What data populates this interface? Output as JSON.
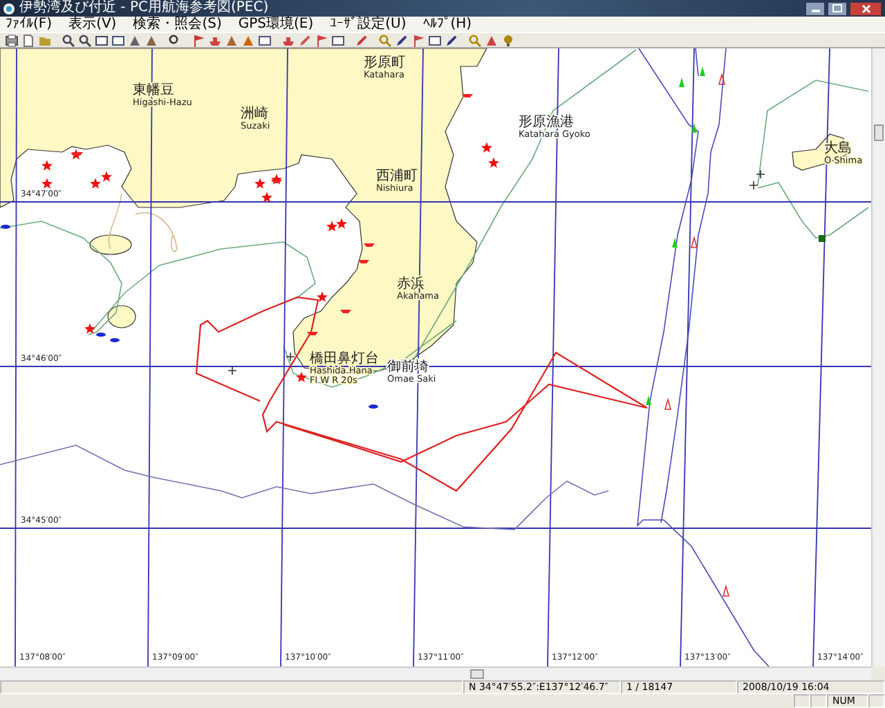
{
  "window": {
    "title": "伊勢湾及び付近 - PC用航海参考図(PEC)"
  },
  "menu": [
    "ﾌｧｲﾙ(F)",
    "表示(V)",
    "検索・照会(S)",
    "GPS環境(E)",
    "ﾕｰｻﾞ設定(U)",
    "ﾍﾙﾌﾟ(H)"
  ],
  "map": {
    "latitude_labels": [
      "34°47′00″",
      "34°46′00″",
      "34°45′00″"
    ],
    "longitude_labels": [
      "137°08′00″",
      "137°09′00″",
      "137°10′00″",
      "137°11′00″",
      "137°12′00″",
      "137°13′00″",
      "137°14′00″"
    ],
    "places": [
      {
        "name": "東幡豆",
        "romaji": "Higashi-Hazu"
      },
      {
        "name": "洲崎",
        "romaji": "Suzaki"
      },
      {
        "name": "形原町",
        "romaji": "Katahara"
      },
      {
        "name": "西浦町",
        "romaji": "Nishiura"
      },
      {
        "name": "赤浜",
        "romaji": "Akahama"
      },
      {
        "name": "形原漁港",
        "romaji": "Katahara Gyoko"
      },
      {
        "name": "大島",
        "romaji": "O Shima"
      },
      {
        "name": "橋田鼻灯台",
        "romaji": "Hashida Hana",
        "note": "Fl W R 20s"
      },
      {
        "name": "御前埼",
        "romaji": "Omae Saki"
      }
    ]
  },
  "status_bar": {
    "position": "N 34°47′55.2″:E137°12′46.7″",
    "record": "1 / 18147",
    "datetime": "2008/10/19 16:04",
    "num": "NUM"
  }
}
